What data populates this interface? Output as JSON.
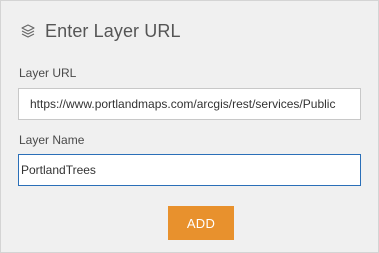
{
  "header": {
    "icon": "layers-icon",
    "title": "Enter Layer URL"
  },
  "form": {
    "url_label": "Layer URL",
    "url_value": "https://www.portlandmaps.com/arcgis/rest/services/Public",
    "name_label": "Layer Name",
    "name_value": "PortlandTrees",
    "add_label": "ADD"
  },
  "colors": {
    "panel_background": "#f0f0f0",
    "accent_button": "#e8912d",
    "focus_border": "#2a6fb8"
  }
}
